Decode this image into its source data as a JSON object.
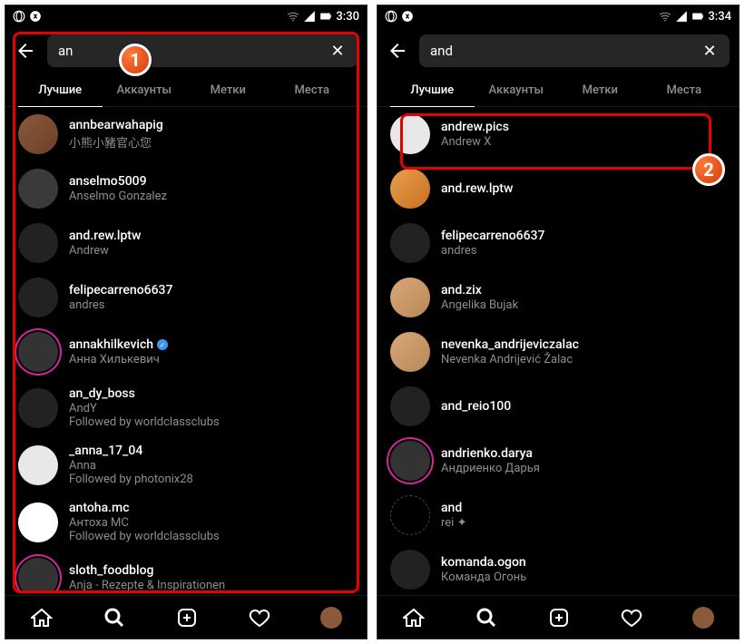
{
  "left": {
    "time": "3:30",
    "search_query": "an",
    "tabs": [
      "Лучшие",
      "Аккаунты",
      "Метки",
      "Места"
    ],
    "results": [
      {
        "username": "annbearwahapig",
        "subtitle": "小熊小豬官心您",
        "avclass": "av-brown"
      },
      {
        "username": "anselmo5009",
        "subtitle": "Anselmo Gonzalez",
        "avclass": "av-gray"
      },
      {
        "username": "and.rew.lptw",
        "subtitle": "Andrew",
        "avclass": "av-dark"
      },
      {
        "username": "felipecarreno6637",
        "subtitle": "andres",
        "avclass": "av-dark"
      },
      {
        "username": "annakhilkevich",
        "subtitle": "Анна Хилькевич",
        "verified": true,
        "story": true,
        "avclass": "av-orange"
      },
      {
        "username": "an_dy_boss",
        "subtitle": "AndY",
        "follow": "Followed by worldclassclubs",
        "avclass": "av-dark"
      },
      {
        "username": "_anna_17_04",
        "subtitle": "Anna",
        "follow": "Followed by photonix28",
        "avclass": "av-white"
      },
      {
        "username": "antoha.mc",
        "subtitle": "Антоха МС",
        "follow": "Followed by worldclassclubs",
        "avclass": "av-logo"
      },
      {
        "username": "sloth_foodblog",
        "subtitle": "Anja - Rezepte & Inspirationen",
        "story": true,
        "avclass": "av-red"
      }
    ]
  },
  "right": {
    "time": "3:34",
    "search_query": "and",
    "tabs": [
      "Лучшие",
      "Аккаунты",
      "Метки",
      "Места"
    ],
    "results": [
      {
        "username": "andrew.pics",
        "subtitle": "Andrew X",
        "avclass": "av-white"
      },
      {
        "username": "and.rew.lptw",
        "subtitle": "",
        "avclass": "av-orange"
      },
      {
        "username": "felipecarreno6637",
        "subtitle": "andres",
        "avclass": "av-dark"
      },
      {
        "username": "and.zix",
        "subtitle": "Angelika Bujak",
        "avclass": "av-skin"
      },
      {
        "username": "nevenka_andrijeviczalac",
        "subtitle": "Nevenka Andrijević Žalac",
        "avclass": "av-skin"
      },
      {
        "username": "and_reio100",
        "subtitle": "",
        "avclass": "av-dark"
      },
      {
        "username": "andrienko.darya",
        "subtitle": "Андриенко Дарья",
        "story": true,
        "avclass": "av-skin"
      },
      {
        "username": "and",
        "subtitle": "rei ✦",
        "dashed": true
      },
      {
        "username": "komanda.ogon",
        "subtitle": "Команда Огонь",
        "avclass": "av-dark"
      }
    ]
  },
  "step1": "1",
  "step2": "2"
}
